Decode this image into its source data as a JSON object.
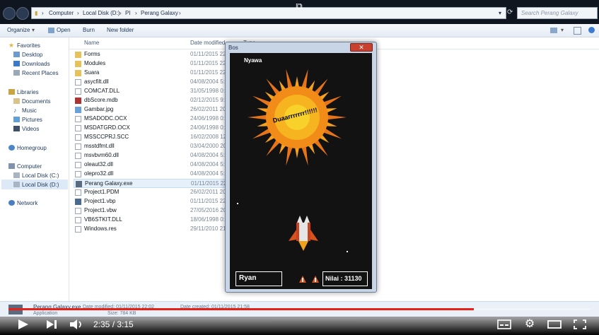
{
  "address_bar": {
    "crumbs": [
      "Computer",
      "Local Disk (D:)",
      "PI",
      "Perang Galaxy"
    ],
    "search_placeholder": "Search Perang Galaxy"
  },
  "toolbar": {
    "organize": "Organize",
    "open": "Open",
    "burn": "Burn",
    "new_folder": "New folder"
  },
  "nav_pane": {
    "favorites": "Favorites",
    "favorites_items": [
      "Desktop",
      "Downloads",
      "Recent Places"
    ],
    "libraries": "Libraries",
    "libraries_items": [
      "Documents",
      "Music",
      "Pictures",
      "Videos"
    ],
    "homegroup": "Homegroup",
    "computer": "Computer",
    "computer_items": [
      "Local Disk (C:)",
      "Local Disk (D:)"
    ],
    "network": "Network"
  },
  "list_header": {
    "name": "Name",
    "date_modified": "Date modified",
    "type": "Type"
  },
  "files": [
    {
      "name": "Forms",
      "date": "01/11/2015 22:0",
      "kind": "folder"
    },
    {
      "name": "Modules",
      "date": "01/11/2015 22:0",
      "kind": "folder"
    },
    {
      "name": "Suara",
      "date": "01/11/2015 22:0",
      "kind": "folder"
    },
    {
      "name": "asycfilt.dll",
      "date": "04/08/2004 5:5",
      "kind": "file"
    },
    {
      "name": "COMCAT.DLL",
      "date": "31/05/1998 0:0",
      "kind": "file"
    },
    {
      "name": "dbScore.mdb",
      "date": "02/12/2015 9:4",
      "kind": "file"
    },
    {
      "name": "Gambar.jpg",
      "date": "26/02/2011 20:0",
      "kind": "file"
    },
    {
      "name": "MSADODC.OCX",
      "date": "24/06/1998 0:0",
      "kind": "file"
    },
    {
      "name": "MSDATGRD.OCX",
      "date": "24/06/1998 0:0",
      "kind": "file"
    },
    {
      "name": "MSSCCPRJ.SCC",
      "date": "16/02/2008 12:3",
      "kind": "file"
    },
    {
      "name": "msstdfmt.dll",
      "date": "03/04/2000 20:0",
      "kind": "file"
    },
    {
      "name": "msvbvm60.dll",
      "date": "04/08/2004 5:5",
      "kind": "file"
    },
    {
      "name": "oleaut32.dll",
      "date": "04/08/2004 5:5",
      "kind": "file"
    },
    {
      "name": "olepro32.dll",
      "date": "04/08/2004 5:5",
      "kind": "file"
    },
    {
      "name": "Perang Galaxy.exe",
      "date": "01/11/2015 22:0",
      "kind": "exe"
    },
    {
      "name": "Project1.PDM",
      "date": "26/02/2011 20:0",
      "kind": "file"
    },
    {
      "name": "Project1.vbp",
      "date": "01/11/2015 22:0",
      "kind": "file"
    },
    {
      "name": "Project1.vbw",
      "date": "27/05/2016 20:4",
      "kind": "file"
    },
    {
      "name": "VB6STKIT.DLL",
      "date": "18/06/1998 0:0",
      "kind": "file"
    },
    {
      "name": "Windows.res",
      "date": "29/11/2010 21:3",
      "kind": "file"
    }
  ],
  "status_bar": {
    "filename": "Perang Galaxy.exe",
    "date_modified": "Date modified: 01/11/2015 22:02",
    "date_created": "Date created: 01/11/2015 21:58",
    "type": "Application",
    "size": "Size: 784 KB"
  },
  "game": {
    "window_title": "Bos",
    "close_glyph": "✕",
    "lives_label": "Nyawa",
    "explosion_text": "Duaarrrrrrr!!!!!!",
    "player_name": "Ryan",
    "score_text": "Nilai : 31130",
    "lives_remaining": 2
  },
  "video_player": {
    "current_time": "2:35",
    "separator": " / ",
    "duration": "3:15",
    "progress": 0.8
  },
  "colors": {
    "progress": "#e62117",
    "game_bg": "#121212",
    "sun_outer": "#f28c18",
    "sun_inner": "#f8d22a"
  }
}
